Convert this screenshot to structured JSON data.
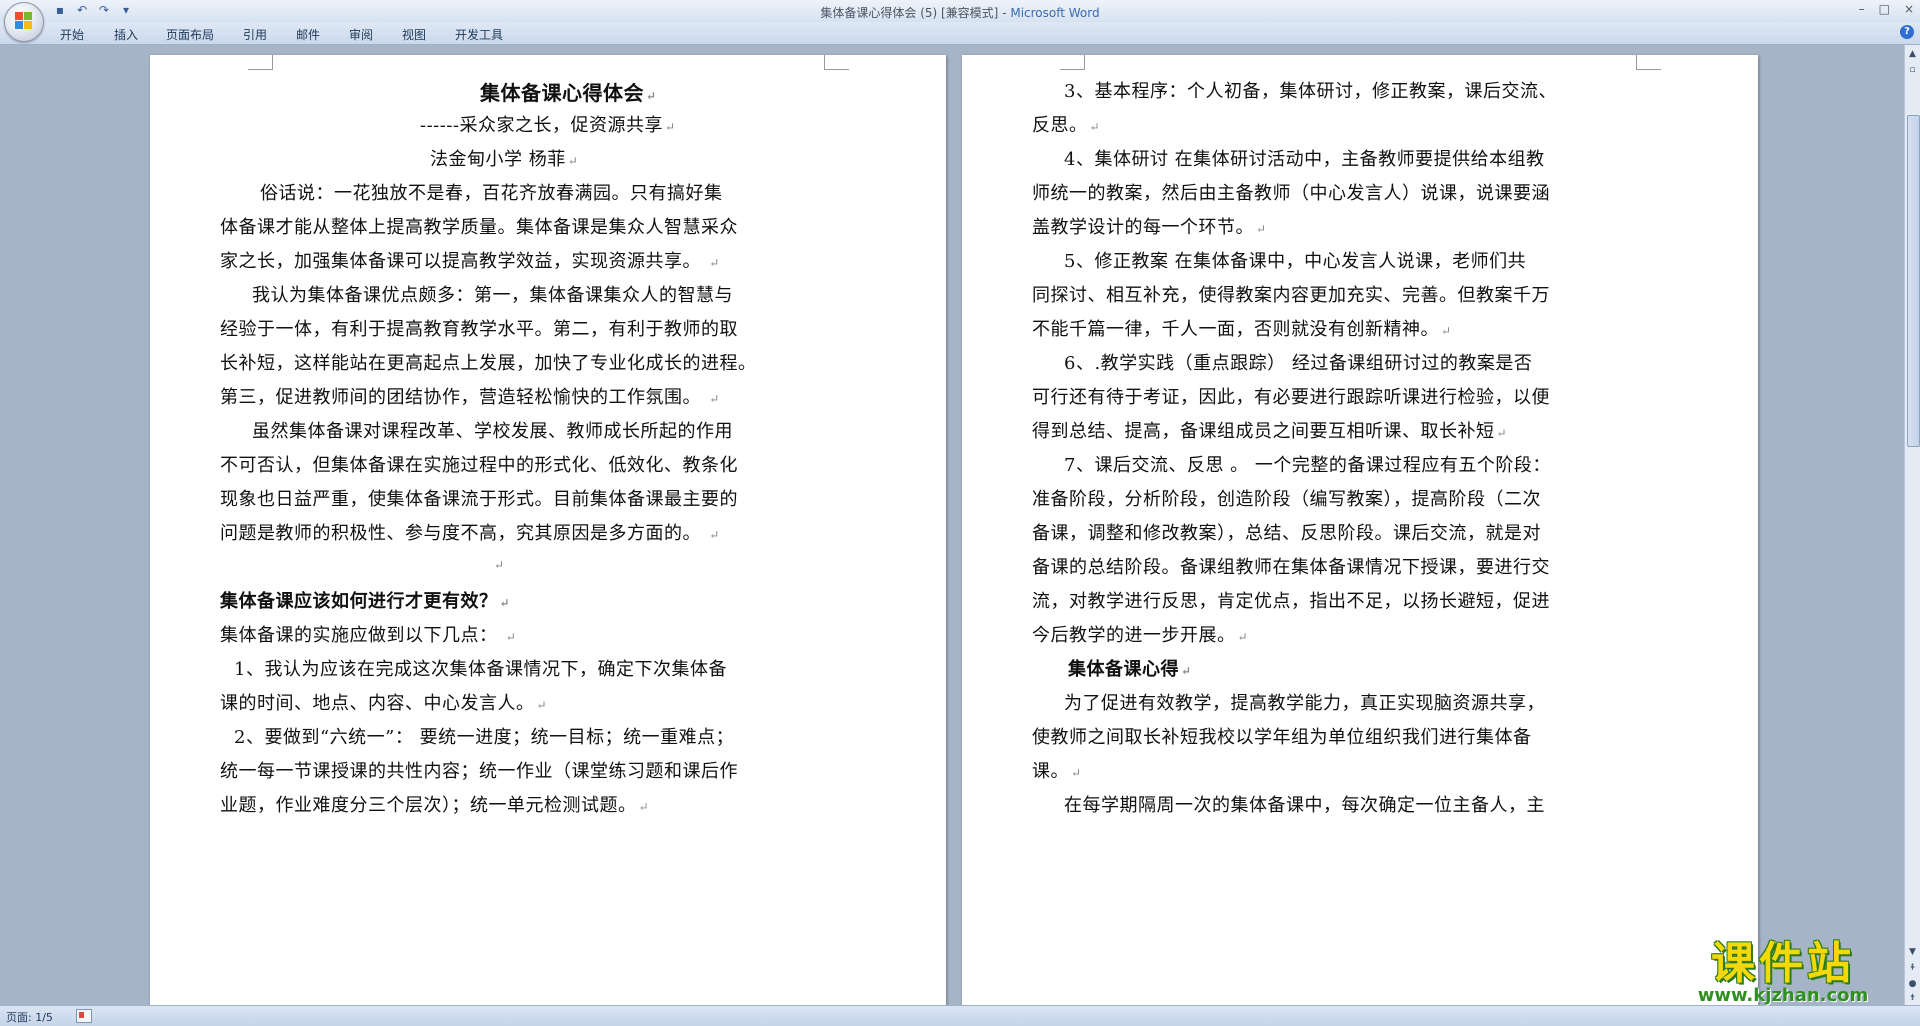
{
  "window": {
    "title": "集体备课心得体会 (5) [兼容模式]",
    "app_name": "Microsoft Word",
    "title_separator": " - ",
    "controls": [
      "–",
      "□",
      "×"
    ]
  },
  "qat": [
    "save-icon",
    "undo-icon",
    "redo-icon",
    "customize-icon"
  ],
  "ribbon": {
    "tabs": [
      "开始",
      "插入",
      "页面布局",
      "引用",
      "邮件",
      "审阅",
      "视图",
      "开发工具"
    ]
  },
  "left_page": {
    "lines": [
      {
        "text": "集体备课心得体会",
        "pm": "↵",
        "bold": true
      },
      {
        "text": "------采众家之长，促资源共享",
        "pm": "↵"
      },
      {
        "text": "法金甸小学     杨菲",
        "pm": "↵"
      },
      {
        "text": "俗话说：一花独放不是春，百花齐放春满园。只有搞好集",
        "pm": ""
      },
      {
        "text": "体备课才能从整体上提高教学质量。集体备课是集众人智慧采众",
        "pm": ""
      },
      {
        "text": "家之长，加强集体备课可以提高教学效益，实现资源共享。 ",
        "pm": "↵"
      },
      {
        "text": "我认为集体备课优点颇多：第一，集体备课集众人的智慧与",
        "pm": ""
      },
      {
        "text": "经验于一体，有利于提高教育教学水平。第二，有利于教师的取",
        "pm": ""
      },
      {
        "text": "长补短，这样能站在更高起点上发展，加快了专业化成长的进程。",
        "pm": ""
      },
      {
        "text": "第三，促进教师间的团结协作，营造轻松愉快的工作氛围。 ",
        "pm": "↵"
      },
      {
        "text": "虽然集体备课对课程改革、学校发展、教师成长所起的作用",
        "pm": ""
      },
      {
        "text": "不可否认，但集体备课在实施过程中的形式化、低效化、教条化",
        "pm": ""
      },
      {
        "text": "现象也日益严重，使集体备课流于形式。目前集体备课最主要的",
        "pm": ""
      },
      {
        "text": "问题是教师的积极性、参与度不高，究其原因是多方面的。 ",
        "pm": "↵"
      },
      {
        "text": "",
        "pm": "↵"
      },
      {
        "text": "集体备课应该如何进行才更有效？",
        "pm": "↵",
        "bold": true
      },
      {
        "text": "集体备课的实施应做到以下几点：  ",
        "pm": "↵"
      },
      {
        "text": "1、我认为应该在完成这次集体备课情况下，确定下次集体备",
        "pm": ""
      },
      {
        "text": "课的时间、地点、内容、中心发言人。",
        "pm": "↵"
      },
      {
        "text": "2、要做到“六统一”： 要统一进度；统一目标；统一重难点；",
        "pm": ""
      },
      {
        "text": "统一每一节课授课的共性内容；统一作业（课堂练习题和课后作",
        "pm": ""
      },
      {
        "text": "业题，作业难度分三个层次）；统一单元检测试题。",
        "pm": "↵"
      }
    ]
  },
  "right_page": {
    "lines": [
      {
        "text": "3、基本程序：个人初备，集体研讨，修正教案，课后交流、",
        "pm": ""
      },
      {
        "text": "反思。",
        "pm": "↵"
      },
      {
        "text": "4、集体研讨 在集体研讨活动中，主备教师要提供给本组教",
        "pm": ""
      },
      {
        "text": "师统一的教案，然后由主备教师（中心发言人）说课，说课要涵",
        "pm": ""
      },
      {
        "text": "盖教学设计的每一个环节。",
        "pm": "↵"
      },
      {
        "text": "5、修正教案  在集体备课中，中心发言人说课，老师们共",
        "pm": ""
      },
      {
        "text": "同探讨、相互补充，使得教案内容更加充实、完善。但教案千万",
        "pm": ""
      },
      {
        "text": "不能千篇一律，千人一面，否则就没有创新精神。",
        "pm": "↵"
      },
      {
        "text": "6、.教学实践（重点跟踪） 经过备课组研讨过的教案是否",
        "pm": ""
      },
      {
        "text": "可行还有待于考证，因此，有必要进行跟踪听课进行检验，以便",
        "pm": ""
      },
      {
        "text": "得到总结、提高，备课组成员之间要互相听课、取长补短",
        "pm": "↵"
      },
      {
        "text": "7、课后交流、反思 。 一个完整的备课过程应有五个阶段：",
        "pm": ""
      },
      {
        "text": "准备阶段，分析阶段，创造阶段（编写教案），提高阶段（二次",
        "pm": ""
      },
      {
        "text": "备课，调整和修改教案），总结、反思阶段。课后交流，就是对",
        "pm": ""
      },
      {
        "text": "备课的总结阶段。备课组教师在集体备课情况下授课，要进行交",
        "pm": ""
      },
      {
        "text": "流，对教学进行反思，肯定优点，指出不足，以扬长避短，促进",
        "pm": ""
      },
      {
        "text": "今后教学的进一步开展。",
        "pm": "↵"
      },
      {
        "text": "集体备课心得",
        "pm": "↵",
        "bold": true
      },
      {
        "text": "为了促进有效教学，提高教学能力，真正实现脑资源共享，",
        "pm": ""
      },
      {
        "text": "使教师之间取长补短我校以学年组为单位组织我们进行集体备",
        "pm": ""
      },
      {
        "text": "课。",
        "pm": "↵"
      },
      {
        "text": "在每学期隔周一次的集体备课中，每次确定一位主备人，主",
        "pm": ""
      }
    ]
  },
  "statusbar": {
    "page_info": "页面: 1/5"
  },
  "watermark": {
    "title": "课件站",
    "url": "www.kjzhan.com"
  },
  "colors": {
    "doc_background": "#a6b4c7",
    "app_name": "#3d6ab0",
    "watermark_yellow": "#f5d80a",
    "watermark_green": "#2f8f1f"
  }
}
